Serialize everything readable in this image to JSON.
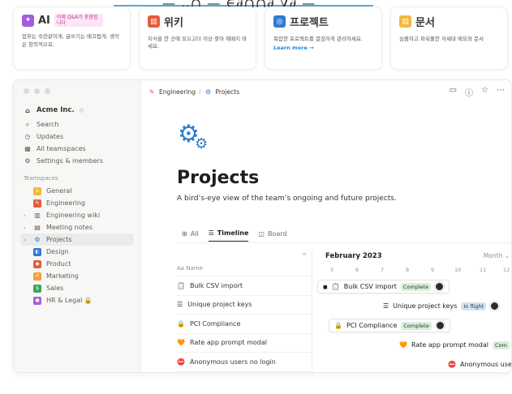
{
  "banner": {
    "scribble": "— ‥∩ — ∈∂∩∩∂ ∇∂ —"
  },
  "cards": [
    {
      "icon": "sparkle-icon",
      "color": "#a75ce0",
      "title": "AI",
      "badge": "이제 Q&A가 포함됩니다",
      "desc": "업무는 숙련같이게, 글쓰기는 매끄럽게. 생각은 창의적으로.",
      "link": ""
    },
    {
      "icon": "book-icon",
      "color": "#e35d3b",
      "title": "위키",
      "badge": "",
      "desc": "지식을 한 곳에 모으고더 이상 찾아 헤매지 마세요.",
      "link": ""
    },
    {
      "icon": "target-icon",
      "color": "#2f7bd5",
      "title": "프로젝트",
      "badge": "",
      "desc": "복잡한 프로젝트를 깔끔하게 관리하세요.",
      "link": "Learn more →"
    },
    {
      "icon": "doc-icon",
      "color": "#f2b93b",
      "title": "문서",
      "badge": "",
      "desc": "심플하고 파워풀한 자세대 메모와 문서",
      "link": ""
    }
  ],
  "sidebar": {
    "workspace": "Acme Inc.",
    "items": [
      {
        "icon": "search-icon",
        "label": "Search"
      },
      {
        "icon": "clock-icon",
        "label": "Updates"
      },
      {
        "icon": "grid-icon",
        "label": "All teamspaces"
      },
      {
        "icon": "gear-icon",
        "label": "Settings & members"
      }
    ],
    "section_label": "Teamspaces",
    "teamspaces": [
      {
        "icon": "home-icon",
        "color": "#f2b93b",
        "label": "General",
        "chev": ""
      },
      {
        "icon": "wrench-icon",
        "color": "#e35d3b",
        "label": "Engineering",
        "chev": ""
      },
      {
        "icon": "book-icon",
        "color": "#777777",
        "label": "Engineering wiki",
        "chev": "›"
      },
      {
        "icon": "note-icon",
        "color": "#777777",
        "label": "Meeting notes",
        "chev": "›"
      },
      {
        "icon": "gears-icon",
        "color": "#2f7bd5",
        "label": "Projects",
        "chev": "›"
      },
      {
        "icon": "palette-icon",
        "color": "#2f7bd5",
        "label": "Design",
        "chev": ""
      },
      {
        "icon": "cube-icon",
        "color": "#e35d3b",
        "label": "Product",
        "chev": ""
      },
      {
        "icon": "megaphone-icon",
        "color": "#f2a03b",
        "label": "Marketing",
        "chev": ""
      },
      {
        "icon": "dollar-icon",
        "color": "#3ba55c",
        "label": "Sales",
        "chev": ""
      },
      {
        "icon": "person-icon",
        "color": "#a75ce0",
        "label": "HR & Legal 🔒",
        "chev": ""
      }
    ]
  },
  "breadcrumb": {
    "parent": "Engineering",
    "separator": "/",
    "current": "Projects"
  },
  "page": {
    "title": "Projects",
    "subtitle": "A bird’s-eye view of the team’s ongoing and future projects."
  },
  "views": [
    {
      "icon": "table-icon",
      "label": "All"
    },
    {
      "icon": "timeline-icon",
      "label": "Timeline"
    },
    {
      "icon": "board-icon",
      "label": "Board"
    }
  ],
  "timeline": {
    "column_header": "Aa  Name",
    "month": "February 2023",
    "scale": "Month ⌄",
    "days": [
      "5",
      "6",
      "7",
      "8",
      "9",
      "10",
      "11",
      "12"
    ],
    "rows": [
      {
        "icon": "📋",
        "name": "Bulk CSV import"
      },
      {
        "icon": "☰",
        "name": "Unique project keys"
      },
      {
        "icon": "🔒",
        "name": "PCI Compliance"
      },
      {
        "icon": "🧡",
        "name": "Rate app prompt modal"
      },
      {
        "icon": "⛔",
        "name": "Anonymous users no login"
      }
    ],
    "bars": [
      {
        "icon": "📋",
        "name": "Bulk CSV import",
        "status": "Complete",
        "status_kind": "green"
      },
      {
        "icon": "☰",
        "name": "Unique project keys",
        "status": "In flight",
        "status_kind": "blue"
      },
      {
        "icon": "🔒",
        "name": "PCI Compliance",
        "status": "Complete",
        "status_kind": "green"
      },
      {
        "icon": "🧡",
        "name": "Rate app prompt modal",
        "status": "Com",
        "status_kind": "green"
      },
      {
        "icon": "⛔",
        "name": "Anonymous use",
        "status": "",
        "status_kind": ""
      }
    ]
  }
}
